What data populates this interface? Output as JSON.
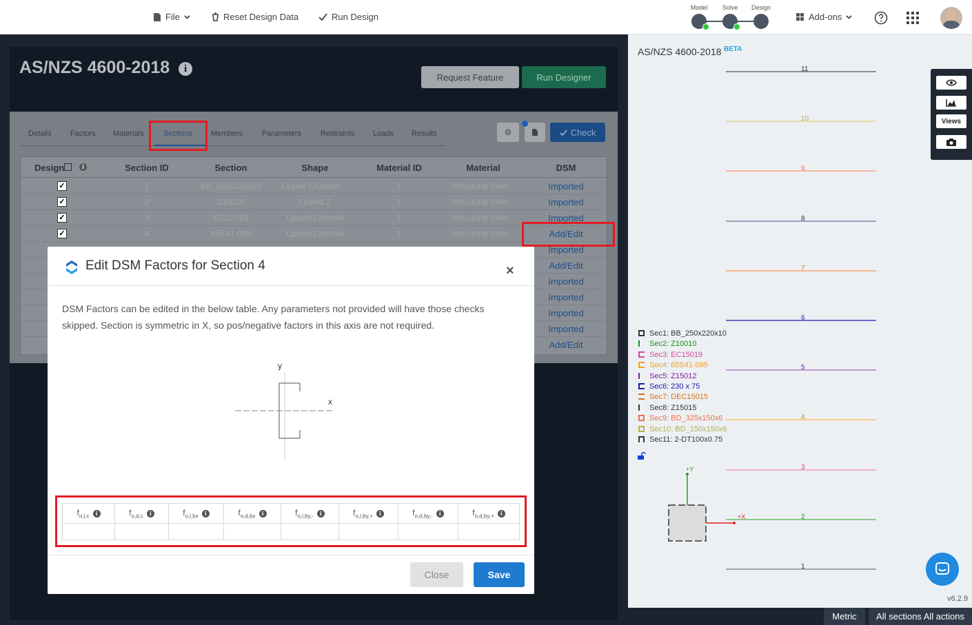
{
  "topbar": {
    "file_label": "File",
    "reset_label": "Reset Design Data",
    "run_label": "Run Design",
    "steps": [
      {
        "label": "Model"
      },
      {
        "label": "Solve"
      },
      {
        "label": "Design"
      }
    ],
    "addons_label": "Add-ons"
  },
  "main": {
    "title": "AS/NZS 4600-2018",
    "request_feature_label": "Request Feature",
    "run_designer_label": "Run Designer",
    "check_label": "Check",
    "tabs": [
      "Details",
      "Factors",
      "Materials",
      "Sections",
      "Members",
      "Parameters",
      "Restraints",
      "Loads",
      "Results"
    ],
    "active_tab": "Sections",
    "columns": [
      "Design",
      "Section ID",
      "Section",
      "Shape",
      "Material ID",
      "Material",
      "DSM"
    ],
    "rows": [
      {
        "id": "1",
        "section": "BB_250x220x10",
        "shape": "Lipped Channel ...",
        "material_id": "1",
        "material": "Structural Stee...",
        "dsm": "Imported"
      },
      {
        "id": "2",
        "section": "Z10010",
        "shape": "Lipped Z",
        "material_id": "1",
        "material": "Structural Stee...",
        "dsm": "Imported"
      },
      {
        "id": "3",
        "section": "EC15019",
        "shape": "Lipped Channel",
        "material_id": "1",
        "material": "Structural Stee...",
        "dsm": "Imported"
      },
      {
        "id": "4",
        "section": "65S41-095",
        "shape": "Lipped Channel",
        "material_id": "1",
        "material": "Structural Stee...",
        "dsm": "Add/Edit"
      },
      {
        "dsm": "Imported"
      },
      {
        "dsm": "Add/Edit"
      },
      {
        "dsm": "Imported"
      },
      {
        "dsm": "Imported"
      },
      {
        "dsm": "Imported"
      },
      {
        "dsm": "Imported"
      },
      {
        "dsm": "Add/Edit"
      }
    ]
  },
  "modal": {
    "title": "Edit DSM Factors for Section 4",
    "close_icon": "×",
    "description": "DSM Factors can be edited in the below table. Any parameters not provided will have those checks skipped. Section is symmetric in X, so pos/negative factors in this axis are not required.",
    "axis_y": "y",
    "axis_x": "x",
    "factors": [
      {
        "base": "f",
        "sub": "o,l,c"
      },
      {
        "base": "f",
        "sub": "o,d,c"
      },
      {
        "base": "f",
        "sub": "o,l,bx"
      },
      {
        "base": "f",
        "sub": "o,d,bx"
      },
      {
        "base": "f",
        "sub": "o,l,by,-"
      },
      {
        "base": "f",
        "sub": "o,l,by,+"
      },
      {
        "base": "f",
        "sub": "o,d,by,-"
      },
      {
        "base": "f",
        "sub": "o,d,by,+"
      }
    ],
    "close_label": "Close",
    "save_label": "Save"
  },
  "right": {
    "title": "AS/NZS 4600-2018",
    "beta": "BETA",
    "levels": [
      "11",
      "10",
      "9",
      "8",
      "7",
      "6",
      "5",
      "4",
      "3",
      "2",
      "1"
    ],
    "legend": [
      {
        "label": "Sec1: BB_250x220x10",
        "color": "#333333"
      },
      {
        "label": "Sec2: Z10010",
        "color": "#1a8a1a"
      },
      {
        "label": "Sec3: EC15019",
        "color": "#d6459a"
      },
      {
        "label": "Sec4: 65S41-095",
        "color": "#f0a020"
      },
      {
        "label": "Sec5: Z15012",
        "color": "#7a1fa0"
      },
      {
        "label": "Sec6: 230 x 75",
        "color": "#1a1aa8"
      },
      {
        "label": "Sec7: DEC15015",
        "color": "#d6701a"
      },
      {
        "label": "Sec8: Z15015",
        "color": "#333333"
      },
      {
        "label": "Sec9: BD_325x150x6",
        "color": "#f26d4f"
      },
      {
        "label": "Sec10: BD_150x150x6",
        "color": "#b9b04a"
      },
      {
        "label": "Sec11: 2-DT100x0.75",
        "color": "#333333"
      }
    ],
    "axis_plus_y": "+Y",
    "axis_plus_x": "+X",
    "views_label": "Views",
    "version": "v6.2.9"
  },
  "statusbar": {
    "units": "Metric",
    "filter": "All sections All actions"
  }
}
